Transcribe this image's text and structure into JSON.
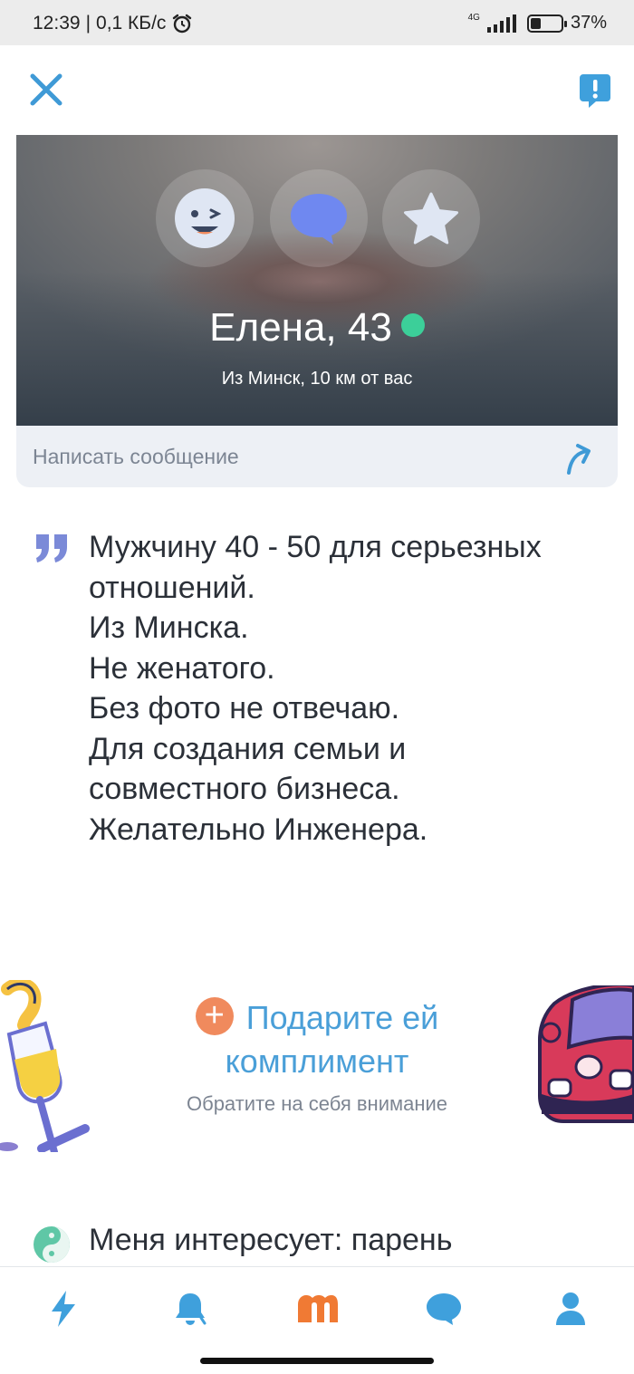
{
  "status_bar": {
    "time": "12:39",
    "network_speed": "0,1 КБ/с",
    "signal": "4G",
    "battery": "37%",
    "battery_level": 0.37
  },
  "header": {
    "close_icon": "close-icon",
    "report_icon": "report-icon"
  },
  "profile": {
    "name_age": "Елена, 43",
    "online": true,
    "location": "Из Минск, 10 км от вас",
    "reactions": [
      "wink-emoji-icon",
      "chat-bubble-icon",
      "star-icon"
    ]
  },
  "message": {
    "placeholder": "Написать сообщение",
    "send_icon": "send-arrow-icon"
  },
  "bio": {
    "lines": [
      "Мужчину 40 - 50 для серьезных",
      "отношений.",
      "Из Минска.",
      "Не женатого.",
      "Без фото не отвечаю.",
      "Для создания семьи и",
      "совместного бизнеса.",
      "Желательно Инженера."
    ]
  },
  "compliment": {
    "title_line1": "Подарите ей",
    "title_line2": "комплимент",
    "subtitle": "Обратите на себя внимание"
  },
  "interest": {
    "text": "Меня интересует: парень"
  },
  "nav": {
    "items": [
      "lightning-icon",
      "bell-icon",
      "mamba-logo-icon",
      "chat-icon",
      "profile-icon"
    ]
  },
  "colors": {
    "accent": "#4a9fd8",
    "online": "#3ccf99",
    "plus": "#f08a5d",
    "mamba": "#f07a34"
  }
}
